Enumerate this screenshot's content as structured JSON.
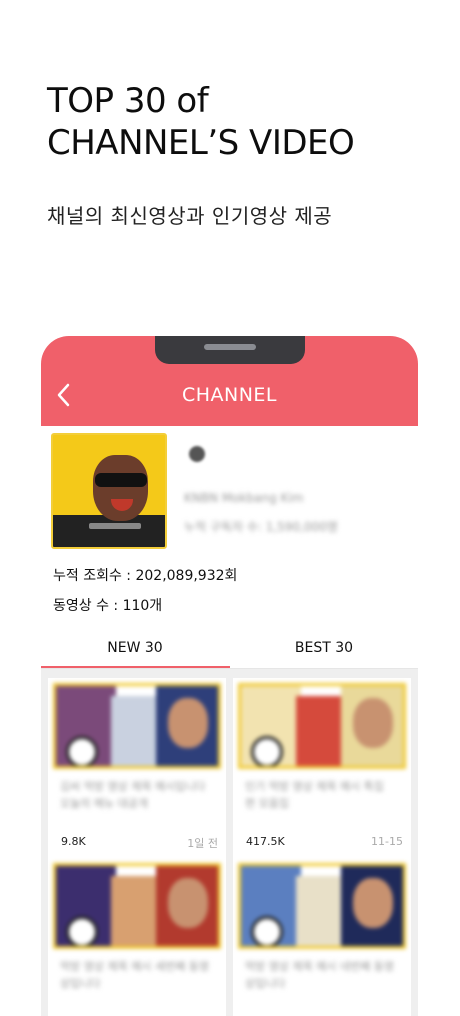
{
  "hero": {
    "title_line1": "TOP 30 of",
    "title_line2": "CHANNEL’S VIDEO",
    "subtitle": "채널의 최신영상과 인기영상 제공"
  },
  "appbar": {
    "title": "CHANNEL",
    "back_icon": "chevron-left-icon",
    "color": "#f0606a"
  },
  "channel": {
    "name": "KNBN Mokbang Kim",
    "meta": "누적 구독자 수: 1,590,000명",
    "total_views_label": "누적 조회수 : 202,089,932회",
    "video_count_label": "동영상 수 : 110개"
  },
  "tabs": [
    {
      "label": "NEW 30",
      "active": true
    },
    {
      "label": "BEST 30",
      "active": false
    }
  ],
  "videos": [
    {
      "title": "김씨 먹방 영상 제목 예시입니다 오늘의 메뉴 대공개",
      "views": "9.8K",
      "date": "1일 전"
    },
    {
      "title": "인기 먹방 영상 제목 예시 특집 편 모음집",
      "views": "417.5K",
      "date": "11-15"
    },
    {
      "title": "먹방 영상 제목 예시 세번째 동영상입니다",
      "views": "",
      "date": ""
    },
    {
      "title": "먹방 영상 제목 예시 네번째 동영상입니다",
      "views": "",
      "date": ""
    }
  ]
}
